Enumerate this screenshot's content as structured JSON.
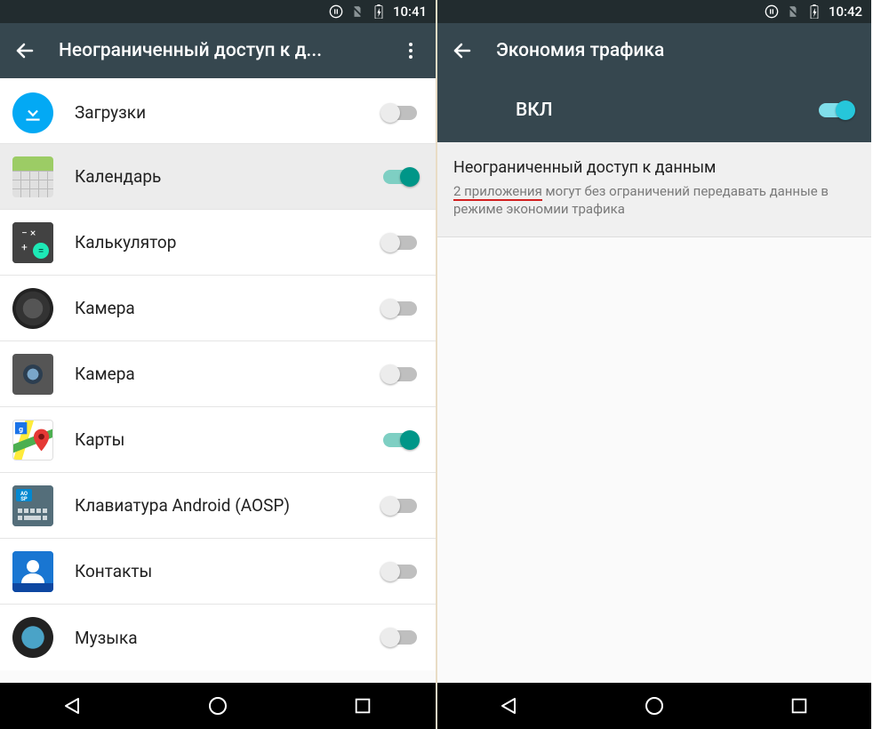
{
  "left": {
    "status_time": "10:41",
    "title": "Неограниченный доступ к д...",
    "apps": [
      {
        "label": "Загрузки",
        "icon": "download-icon",
        "on": false
      },
      {
        "label": "Календарь",
        "icon": "calendar-icon",
        "on": true
      },
      {
        "label": "Калькулятор",
        "icon": "calculator-icon",
        "on": false
      },
      {
        "label": "Камера",
        "icon": "camera-icon",
        "on": false
      },
      {
        "label": "Камера",
        "icon": "camera2-icon",
        "on": false
      },
      {
        "label": "Карты",
        "icon": "maps-icon",
        "on": true
      },
      {
        "label": "Клавиатура Android (AOSP)",
        "icon": "keyboard-icon",
        "on": false
      },
      {
        "label": "Контакты",
        "icon": "contacts-icon",
        "on": false
      },
      {
        "label": "Музыка",
        "icon": "music-icon",
        "on": false
      }
    ]
  },
  "right": {
    "status_time": "10:42",
    "title": "Экономия трафика",
    "master_label": "ВКЛ",
    "master_on": true,
    "detail_title": "Неограниченный доступ к данным",
    "detail_count": "2 приложения",
    "detail_rest": " могут без ограничений передавать данные в режиме экономии трафика"
  }
}
